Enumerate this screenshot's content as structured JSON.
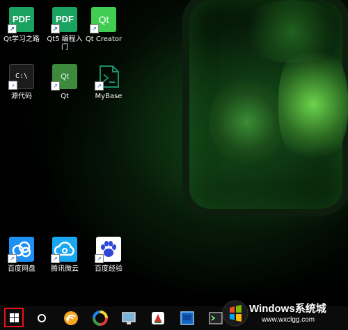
{
  "desktop": {
    "icons": [
      {
        "label": "Qt学习之路",
        "glyph": "PDF",
        "icon": "pdf-icon"
      },
      {
        "label": "Qt5 编程入门",
        "glyph": "PDF",
        "icon": "pdf-icon"
      },
      {
        "label": "Qt Creator",
        "glyph": "Qt",
        "icon": "qt-creator-icon"
      },
      {
        "label": "源代码",
        "glyph": "C:\\",
        "icon": "cmd-icon"
      },
      {
        "label": "Qt",
        "glyph": "Qt",
        "icon": "qt-file-icon"
      },
      {
        "label": "MyBase",
        "glyph": "",
        "icon": "mybase-icon"
      },
      {
        "label": "百度网盘",
        "glyph": "",
        "icon": "baidu-netdisk-icon"
      },
      {
        "label": "腾讯微云",
        "glyph": "",
        "icon": "tencent-weiyun-icon"
      },
      {
        "label": "百度经验",
        "glyph": "",
        "icon": "baidu-jingyan-icon"
      }
    ],
    "shortcut_glyph": "↗"
  },
  "taskbar": {
    "items": [
      "start-button",
      "cortana-search",
      "browser",
      "app-colorful",
      "app-monitor",
      "app-red",
      "app-blue",
      "app-terminal",
      "app-dark"
    ]
  },
  "watermark": {
    "title": "Windows系统城",
    "url": "www.wxclgg.com"
  },
  "colors": {
    "start_highlight": "#e11111",
    "pdf_green": "#1aa260",
    "qt_green": "#41cd52"
  }
}
